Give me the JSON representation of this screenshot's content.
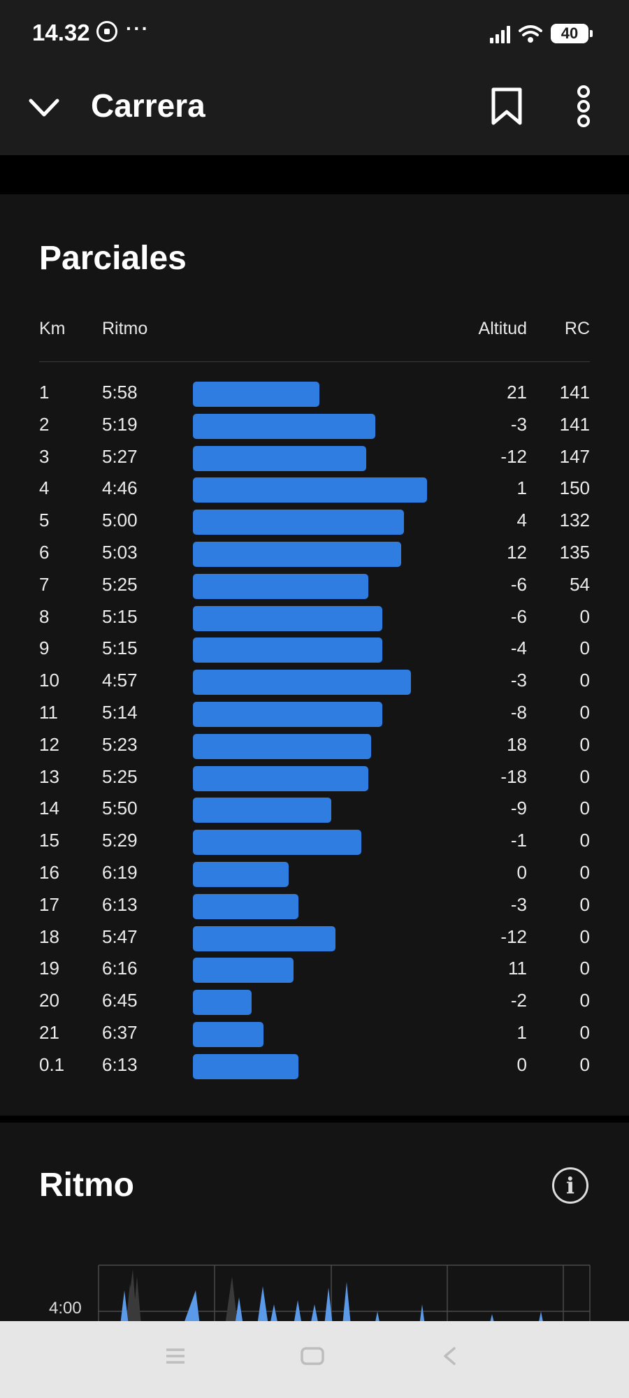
{
  "status": {
    "time": "14.32",
    "battery": "40"
  },
  "appbar": {
    "title": "Carrera"
  },
  "splits": {
    "title": "Parciales",
    "headers": {
      "km": "Km",
      "pace": "Ritmo",
      "altitude": "Altitud",
      "hr": "RC"
    },
    "rows": [
      {
        "km": "1",
        "pace": "5:58",
        "altitude": "21",
        "hr": "141",
        "bar_fraction": 0.54
      },
      {
        "km": "2",
        "pace": "5:19",
        "altitude": "-3",
        "hr": "141",
        "bar_fraction": 0.78
      },
      {
        "km": "3",
        "pace": "5:27",
        "altitude": "-12",
        "hr": "147",
        "bar_fraction": 0.74
      },
      {
        "km": "4",
        "pace": "4:46",
        "altitude": "1",
        "hr": "150",
        "bar_fraction": 1.0
      },
      {
        "km": "5",
        "pace": "5:00",
        "altitude": "4",
        "hr": "132",
        "bar_fraction": 0.9
      },
      {
        "km": "6",
        "pace": "5:03",
        "altitude": "12",
        "hr": "135",
        "bar_fraction": 0.89
      },
      {
        "km": "7",
        "pace": "5:25",
        "altitude": "-6",
        "hr": "54",
        "bar_fraction": 0.75
      },
      {
        "km": "8",
        "pace": "5:15",
        "altitude": "-6",
        "hr": "0",
        "bar_fraction": 0.81
      },
      {
        "km": "9",
        "pace": "5:15",
        "altitude": "-4",
        "hr": "0",
        "bar_fraction": 0.81
      },
      {
        "km": "10",
        "pace": "4:57",
        "altitude": "-3",
        "hr": "0",
        "bar_fraction": 0.93
      },
      {
        "km": "11",
        "pace": "5:14",
        "altitude": "-8",
        "hr": "0",
        "bar_fraction": 0.81
      },
      {
        "km": "12",
        "pace": "5:23",
        "altitude": "18",
        "hr": "0",
        "bar_fraction": 0.76
      },
      {
        "km": "13",
        "pace": "5:25",
        "altitude": "-18",
        "hr": "0",
        "bar_fraction": 0.75
      },
      {
        "km": "14",
        "pace": "5:50",
        "altitude": "-9",
        "hr": "0",
        "bar_fraction": 0.59
      },
      {
        "km": "15",
        "pace": "5:29",
        "altitude": "-1",
        "hr": "0",
        "bar_fraction": 0.72
      },
      {
        "km": "16",
        "pace": "6:19",
        "altitude": "0",
        "hr": "0",
        "bar_fraction": 0.41
      },
      {
        "km": "17",
        "pace": "6:13",
        "altitude": "-3",
        "hr": "0",
        "bar_fraction": 0.45
      },
      {
        "km": "18",
        "pace": "5:47",
        "altitude": "-12",
        "hr": "0",
        "bar_fraction": 0.61
      },
      {
        "km": "19",
        "pace": "6:16",
        "altitude": "11",
        "hr": "0",
        "bar_fraction": 0.43
      },
      {
        "km": "20",
        "pace": "6:45",
        "altitude": "-2",
        "hr": "0",
        "bar_fraction": 0.25
      },
      {
        "km": "21",
        "pace": "6:37",
        "altitude": "1",
        "hr": "0",
        "bar_fraction": 0.3
      },
      {
        "km": "0.1",
        "pace": "6:13",
        "altitude": "0",
        "hr": "0",
        "bar_fraction": 0.45
      }
    ]
  },
  "pace_section": {
    "title": "Ritmo",
    "y_tick": "4:00"
  },
  "colors": {
    "bar": "#2f7de0",
    "card": "#141414",
    "appbar": "#1c1c1c"
  }
}
